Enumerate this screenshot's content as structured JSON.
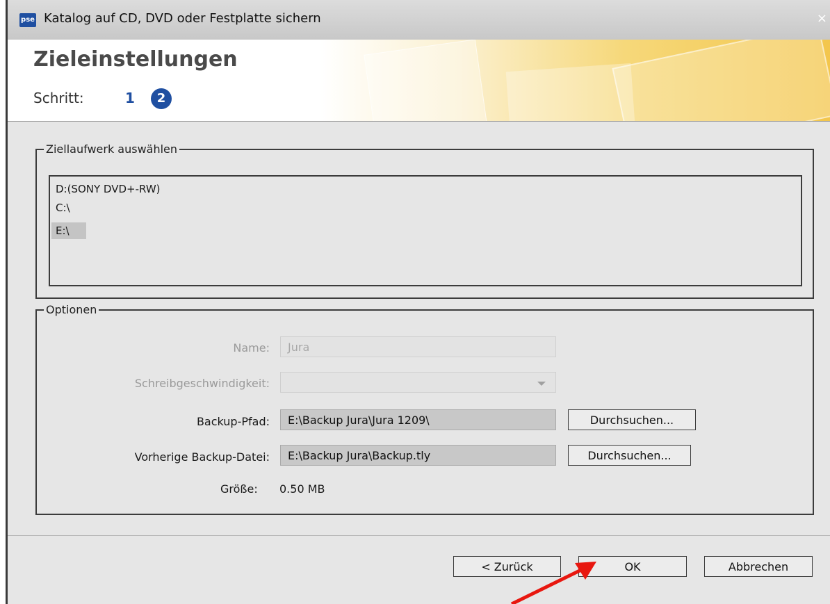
{
  "window": {
    "app_icon_text": "pse",
    "title": "Katalog auf CD, DVD oder Festplatte sichern",
    "close_label": "×"
  },
  "header": {
    "title": "Zieleinstellungen",
    "step_label": "Schritt:",
    "step_1": "1",
    "step_2": "2",
    "current_step": 2
  },
  "drive_group": {
    "legend": "Ziellaufwerk auswählen",
    "items": [
      {
        "label": "D:(SONY DVD+-RW)",
        "selected": false
      },
      {
        "label": "C:\\",
        "selected": false
      },
      {
        "label": "E:\\",
        "selected": true
      }
    ]
  },
  "options_group": {
    "legend": "Optionen",
    "name_label": "Name:",
    "name_value": "Jura",
    "speed_label": "Schreibgeschwindigkeit:",
    "speed_value": "",
    "backup_path_label": "Backup-Pfad:",
    "backup_path_value": "E:\\Backup Jura\\Jura 1209\\",
    "browse_label_1": "Durchsuchen...",
    "prev_backup_label": "Vorherige Backup-Datei:",
    "prev_backup_value": "E:\\Backup Jura\\Backup.tly",
    "browse_label_2": "Durchsuchen...",
    "size_label": "Größe:",
    "size_value": "0.50 MB"
  },
  "footer": {
    "back_label": "< Zurück",
    "ok_label": "OK",
    "cancel_label": "Abbrechen"
  },
  "annotation": {
    "arrow_color": "#e8170f"
  },
  "colors": {
    "accent": "#1f4fa1",
    "dialog_bg": "#e6e6e6",
    "header_gradient_end": "#f3c64c"
  }
}
